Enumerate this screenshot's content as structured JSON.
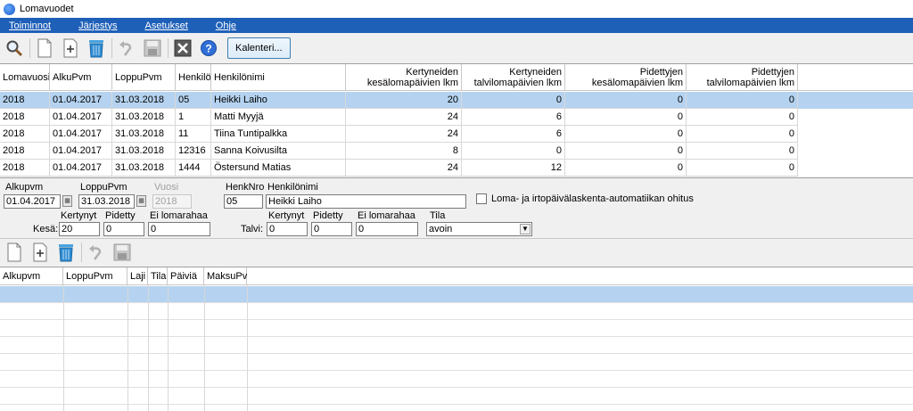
{
  "window": {
    "title": "Lomavuodet"
  },
  "menu": [
    "Toiminnot",
    "Järjestys",
    "Asetukset",
    "Ohje"
  ],
  "toolbar": {
    "icons": [
      "search-icon",
      "new-document-icon",
      "add-icon",
      "delete-icon",
      "undo-icon",
      "save-icon",
      "close-icon",
      "help-icon"
    ],
    "calendar_label": "Kalenteri..."
  },
  "grid": {
    "headers": [
      "Lomavuosi",
      "AlkuPvm",
      "LoppuPvm",
      "Henkilö",
      "Henkilönimi",
      "Kertyneiden kesälomapäivien lkm",
      "Kertyneiden talvilomapäivien lkm",
      "Pidettyjen kesälomapäivien lkm",
      "Pidettyjen talvilomapäivien lkm"
    ],
    "rows": [
      [
        "2018",
        "01.04.2017",
        "31.03.2018",
        "05",
        "Heikki Laiho",
        "20",
        "0",
        "0",
        "0"
      ],
      [
        "2018",
        "01.04.2017",
        "31.03.2018",
        "1",
        "Matti Myyjä",
        "24",
        "6",
        "0",
        "0"
      ],
      [
        "2018",
        "01.04.2017",
        "31.03.2018",
        "11",
        "Tiina Tuntipalkka",
        "24",
        "6",
        "0",
        "0"
      ],
      [
        "2018",
        "01.04.2017",
        "31.03.2018",
        "12316",
        "Sanna Koivusilta",
        "8",
        "0",
        "0",
        "0"
      ],
      [
        "2018",
        "01.04.2017",
        "31.03.2018",
        "1444",
        "Östersund Matias",
        "24",
        "12",
        "0",
        "0"
      ]
    ]
  },
  "form": {
    "alkupvm_label": "Alkupvm",
    "alkupvm_value": "01.04.2017",
    "loppupvm_label": "LoppuPvm",
    "loppupvm_value": "31.03.2018",
    "vuosi_label": "Vuosi",
    "vuosi_value": "2018",
    "henknro_label": "HenkNro",
    "henknro_value": "05",
    "henkilonimi_label": "Henkilönimi",
    "henkilonimi_value": "Heikki Laiho",
    "override_label": "Loma- ja irtopäivälaskenta-automatiikan ohitus",
    "kesa_label": "Kesä:",
    "talvi_label": "Talvi:",
    "kertynyt_label": "Kertynyt",
    "pidetty_label": "Pidetty",
    "ei_lomarahaa_label": "Ei lomarahaa",
    "tila_label": "Tila",
    "kesa_kertynyt": "20",
    "kesa_pidetty": "0",
    "kesa_ei_lomarahaa": "0",
    "talvi_kertynyt": "0",
    "talvi_pidetty": "0",
    "talvi_ei_lomarahaa": "0",
    "tila_value": "avoin"
  },
  "grid2": {
    "headers": [
      "Alkupvm",
      "LoppuPvm",
      "Laji",
      "Tila",
      "Päiviä",
      "MaksuPv"
    ]
  }
}
